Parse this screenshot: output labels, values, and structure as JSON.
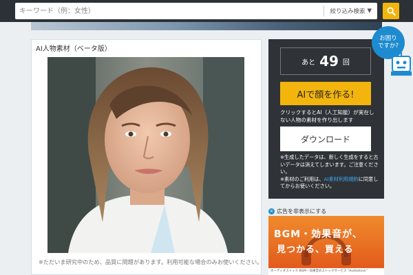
{
  "search": {
    "placeholder": "キーワード（例：女性）",
    "refine_label": "絞り込み検索",
    "refine_arrow": "▼"
  },
  "main": {
    "title": "AI人物素材（ベータ版）",
    "note": "※ただいま研究中のため、品質に問題があります。利用可能な場合のみお使いください。"
  },
  "side": {
    "count_prefix": "あと",
    "count_value": "49",
    "count_suffix": "回",
    "create_label": "AIで顔を作る!",
    "description": "クリックするとAI（人工知能）が実在しない人物の素材を作り出します",
    "download_label": "ダウンロード",
    "note1": "※生成したデータは、新しく生成をすると古いデータは消えてしまいます。ご注意ください。",
    "note2_prefix": "※素材のご利用は、",
    "note2_link": "AI素材利用規約",
    "note2_suffix": "に同意してからお使いください。"
  },
  "ad": {
    "hide_label": "広告を非表示にする",
    "title_line1": "BGM・効果音が、",
    "title_line2": "見つかる、買える",
    "footer": "オーディオストック BGM・効果音のストックサービス \"Audiostock\""
  },
  "help": {
    "line1": "お困り",
    "line2": "ですか?"
  },
  "colors": {
    "accent": "#f3b50d",
    "topbar": "#2b3137",
    "panel": "#2f3337",
    "help": "#1e8bd0",
    "link": "#3fa9f5"
  }
}
